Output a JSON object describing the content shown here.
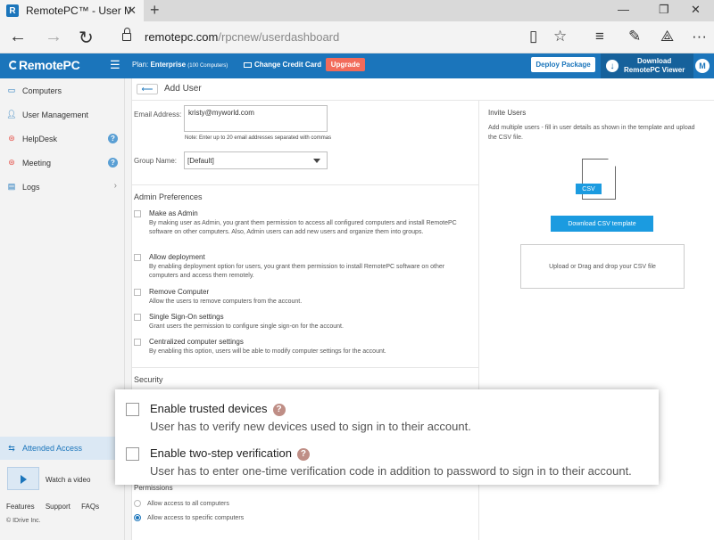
{
  "browser": {
    "tab_title": "RemotePC™ - User Man",
    "tab_logo": "R",
    "url_host": "remotepc.com",
    "url_path": "/rpcnew/userdashboard"
  },
  "header": {
    "brand": "RemotePC",
    "plan_label": "Plan:",
    "plan_name": "Enterprise",
    "plan_detail": "(100 Computers)",
    "change_card": "Change Credit Card",
    "upgrade": "Upgrade",
    "deploy": "Deploy Package",
    "download_line1": "Download",
    "download_line2": "RemotePC Viewer",
    "avatar": "M"
  },
  "sidebar": {
    "items": [
      {
        "label": "Computers",
        "icon": "monitor-icon"
      },
      {
        "label": "User Management",
        "icon": "user-icon"
      },
      {
        "label": "HelpDesk",
        "icon": "lifebuoy-icon"
      },
      {
        "label": "Meeting",
        "icon": "lifebuoy-icon"
      },
      {
        "label": "Logs",
        "icon": "document-icon"
      }
    ],
    "attended_access": "Attended Access",
    "watch_video": "Watch a video",
    "footer_features": "Features",
    "footer_support": "Support",
    "footer_faqs": "FAQs",
    "copyright": "© IDrive Inc."
  },
  "add_user": {
    "title": "Add User",
    "email_label": "Email Address:",
    "email_value": "kristy@myworld.com",
    "email_note": "Note: Enter up to 20 email addresses separated with commas",
    "group_label": "Group Name:",
    "group_value": "[Default]"
  },
  "admin_prefs": {
    "heading": "Admin Preferences",
    "items": [
      {
        "title": "Make as Admin",
        "desc": "By making user as Admin, you grant them permission to access all configured computers and install RemotePC software on other computers. Also, Admin users can add new users and organize them into groups."
      },
      {
        "title": "Allow deployment",
        "desc": "By enabling deployment option for users, you grant them permission to install RemotePC software on other computers and access them remotely."
      },
      {
        "title": "Remove Computer",
        "desc": "Allow the users to remove computers from the account."
      },
      {
        "title": "Single Sign-On settings",
        "desc": "Grant users the permission to configure single sign-on for the account."
      },
      {
        "title": "Centralized computer settings",
        "desc": "By enabling this option, users will be able to modify computer settings for the account."
      }
    ]
  },
  "security": {
    "heading": "Security"
  },
  "permissions": {
    "heading": "Permissions",
    "option_all": "Allow access to all computers",
    "option_specific": "Allow access to specific computers"
  },
  "invite": {
    "heading": "Invite Users",
    "desc": "Add multiple users - fill in user details as shown in the template and upload the CSV file.",
    "csv_tag": "CSV",
    "download_template": "Download CSV template",
    "dropzone": "Upload or Drag and drop your CSV file"
  },
  "highlight": {
    "trusted_title": "Enable trusted devices",
    "trusted_desc": "User has to verify new devices used to sign in to their account.",
    "twostep_title": "Enable two-step verification",
    "twostep_desc": "User has to enter one-time verification code in addition to password to sign in to their account.",
    "help_glyph": "?"
  }
}
